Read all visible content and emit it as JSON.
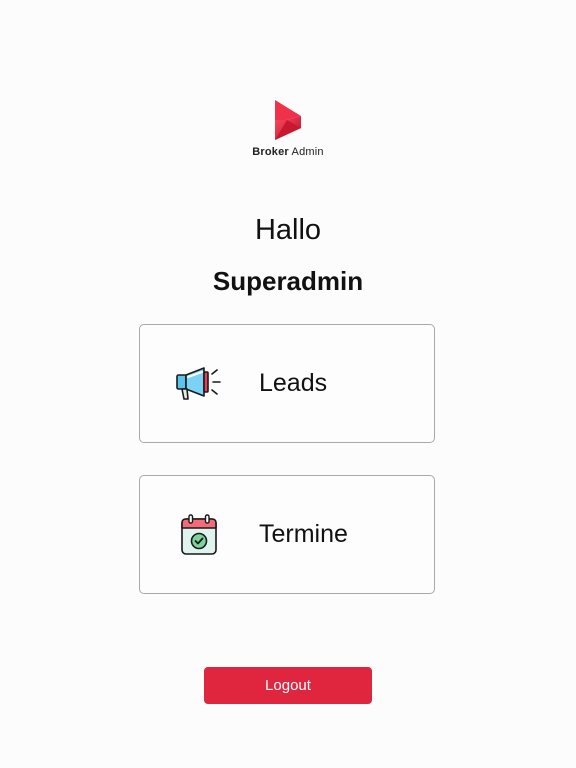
{
  "brand": {
    "name_bold": "Broker",
    "name_light": " Admin",
    "logo_icon": "brand-logo-icon",
    "accent": "#e0253f"
  },
  "greeting": {
    "hello": "Hallo",
    "username": "Superadmin"
  },
  "menu": [
    {
      "label": "Leads",
      "icon": "megaphone-icon"
    },
    {
      "label": "Termine",
      "icon": "calendar-check-icon"
    }
  ],
  "logout_label": "Logout"
}
